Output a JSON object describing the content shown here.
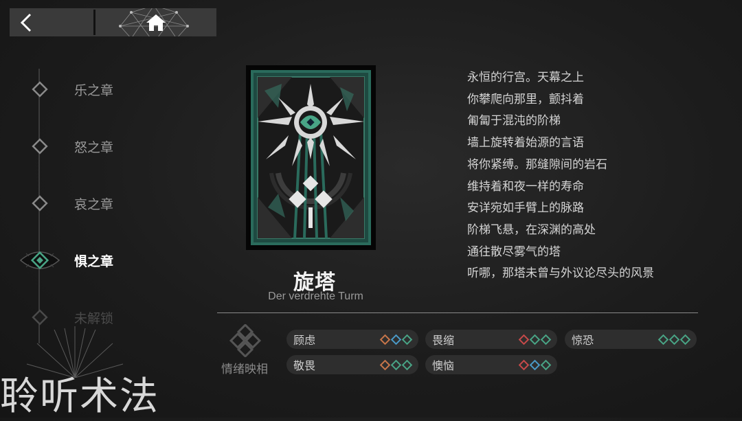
{
  "nav": {
    "back_icon": "chevron-left-icon",
    "home_icon": "home-icon"
  },
  "chapters": [
    {
      "label": "乐之章",
      "state": "normal"
    },
    {
      "label": "怒之章",
      "state": "normal"
    },
    {
      "label": "哀之章",
      "state": "normal"
    },
    {
      "label": "惧之章",
      "state": "active"
    },
    {
      "label": "未解锁",
      "state": "locked"
    }
  ],
  "card": {
    "title": "旋塔",
    "subtitle": "Der verdrehte Turm"
  },
  "poem": [
    "永恒的行宫。天幕之上",
    "你攀爬向那里，颤抖着",
    "匍匐于混沌的阶梯",
    "墙上旋转着始源的言语",
    "将你紧缚。那缝隙间的岩石",
    "维持着和夜一样的寿命",
    "安详宛如手臂上的脉路",
    "阶梯飞悬，在深渊的高处",
    "通往散尽雾气的塔",
    "听哪，那塔未曾与外议论尽头的风景"
  ],
  "emotions": {
    "title": "情绪映相",
    "items": [
      {
        "label": "顾虑",
        "diamonds": [
          "#c8764a",
          "#4a9ac8",
          "#49a586"
        ]
      },
      {
        "label": "畏缩",
        "diamonds": [
          "#c84a4a",
          "#49a586",
          "#49a586"
        ]
      },
      {
        "label": "惊恐",
        "diamonds": [
          "#49a586",
          "#49a586",
          "#49a586"
        ]
      },
      {
        "label": "敬畏",
        "diamonds": [
          "#c8764a",
          "#49a586",
          "#49a586"
        ]
      },
      {
        "label": "懊恼",
        "diamonds": [
          "#c84a4a",
          "#4a9ac8",
          "#49a586"
        ]
      }
    ]
  },
  "watermark": "聆听术法",
  "colors": {
    "accent": "#49a586",
    "card_teal": "#2a6b5c",
    "background": "#1c1c1c"
  }
}
